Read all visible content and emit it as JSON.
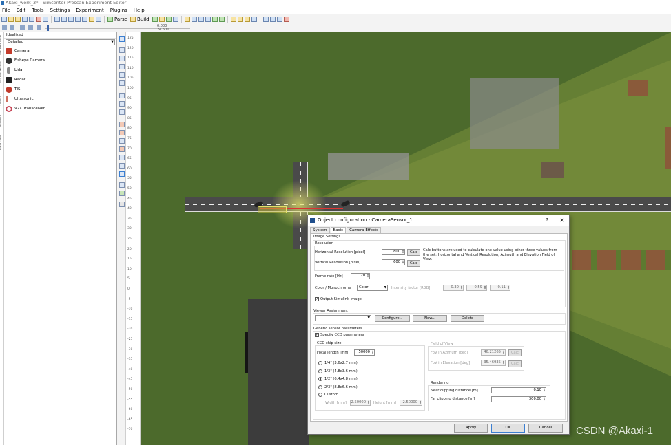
{
  "window": {
    "title": "Akaxi_work_3* - Simcenter Prescan Experiment Editor"
  },
  "menu": [
    "File",
    "Edit",
    "Tools",
    "Settings",
    "Experiment",
    "Plugins",
    "Help"
  ],
  "toolbar": {
    "parse_label": "Parse",
    "build_label": "Build"
  },
  "timeline": {
    "value1": "0.000",
    "value2": "24.600"
  },
  "library": {
    "vertical_tabs": [
      "Environment",
      "Infrastructure",
      "Actors",
      "Sensors",
      "Vitra Aids"
    ],
    "header": "Idealized",
    "dropdown": "Detailed",
    "items": [
      {
        "label": "Camera",
        "color": "#c33a2a"
      },
      {
        "label": "Fisheye Camera",
        "color": "#333333"
      },
      {
        "label": "Lidar",
        "color": "#8a8a8a"
      },
      {
        "label": "Radar",
        "color": "#222222"
      },
      {
        "label": "TIS",
        "color": "#c03a2b"
      },
      {
        "label": "Ultrasonic",
        "color": "#d07060"
      },
      {
        "label": "V2X Transceiver",
        "color": "#c84a5a"
      }
    ]
  },
  "ruler_ticks": [
    "125",
    "120",
    "115",
    "110",
    "105",
    "100",
    "95",
    "90",
    "85",
    "80",
    "75",
    "70",
    "65",
    "60",
    "55",
    "50",
    "45",
    "40",
    "35",
    "30",
    "25",
    "20",
    "15",
    "10",
    "5",
    "0",
    "-5",
    "-10",
    "-15",
    "-20",
    "-25",
    "-30",
    "-35",
    "-40",
    "-45",
    "-50",
    "-55",
    "-60",
    "-65",
    "-70"
  ],
  "dialog": {
    "title": "Object configuration - CameraSensor_1",
    "help": "?",
    "close": "✕",
    "tabs": [
      "System",
      "Basic",
      "Camera Effects"
    ],
    "image_settings": "Image Settings",
    "resolution": "Resolution",
    "h_res_label": "Horizontal Resolution [pixel]",
    "h_res": "800",
    "v_res_label": "Vertical Resolution [pixel]",
    "v_res": "600",
    "calc": "Calc",
    "calc_note": "Calc buttons are used to calculate one value using other three values from the set: Horizontal and Vertical Resolution, Azimuth and Elevation Field of View.",
    "frame_rate_label": "Frame rate [Hz]",
    "frame_rate": "20",
    "color_label": "Color / Monochrome",
    "color_value": "Color",
    "intensity_label": "Intensity factor [RGB]",
    "intensity": [
      "0.30",
      "0.59",
      "0.11"
    ],
    "output_label": "Output Simulink Image",
    "viewer_label": "Viewer Assignment",
    "configure": "Configure...",
    "new": "New...",
    "delete": "Delete",
    "generic_label": "Generic sensor parameters",
    "specify_ccd": "Specify CCD parameters",
    "ccd_chip_size": "CCD chip size",
    "focal_label": "Focal length [mm]",
    "focal": "50000",
    "ccd_options": [
      "1/4\" (3.6x2.7 mm)",
      "1/3\" (4.8x3.6 mm)",
      "1/2\" (6.4x4.8 mm)",
      "2/3\" (8.8x6.6 mm)",
      "Custom"
    ],
    "width_label": "Width [mm]",
    "width": "2.50000",
    "height_label": "Height [mm]",
    "height": "2.50000",
    "fov_label": "Field of View",
    "fov_az_label": "FoV in Azimuth [deg]",
    "fov_az": "46.21265",
    "fov_el_label": "FoV in Elevation [deg]",
    "fov_el": "35.46935",
    "rendering_label": "Rendering",
    "near_label": "Near clipping distance [m]",
    "near": "0.10",
    "far_label": "Far clipping distance [m]",
    "far": "300.00",
    "apply": "Apply",
    "ok": "OK",
    "cancel": "Cancel"
  },
  "watermark": "CSDN @Akaxi-1"
}
